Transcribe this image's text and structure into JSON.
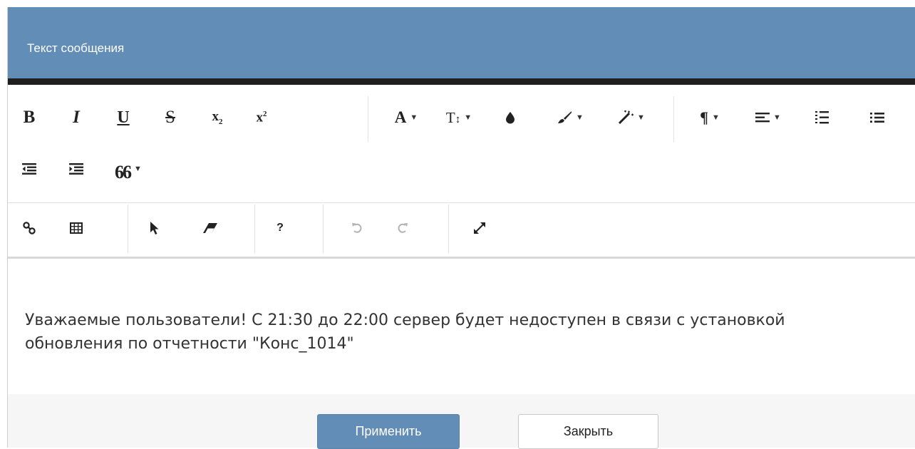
{
  "header": {
    "title": "Текст сообщения"
  },
  "colors": {
    "header_bg": "#628db7",
    "apply_bg": "#628db7"
  },
  "toolbar": {
    "bold": "B",
    "italic": "I",
    "underline": "U",
    "strikethrough": "S",
    "subscript_base": "x",
    "subscript_mark": "2",
    "superscript_base": "x",
    "superscript_mark": "2",
    "font_color": "A",
    "font_size": "T",
    "font_size_arrows": "↕",
    "paragraph": "¶",
    "quote": "66",
    "help": "?",
    "caret": "▼"
  },
  "icons": [
    "bold-icon",
    "italic-icon",
    "underline-icon",
    "strikethrough-icon",
    "subscript-icon",
    "superscript-icon",
    "font-color-icon",
    "font-size-icon",
    "drop-icon",
    "brush-icon",
    "magic-wand-icon",
    "paragraph-icon",
    "align-icon",
    "ordered-list-icon",
    "unordered-list-icon",
    "outdent-icon",
    "indent-icon",
    "quote-icon",
    "link-icon",
    "table-icon",
    "cursor-icon",
    "eraser-icon",
    "help-icon",
    "undo-icon",
    "redo-icon",
    "fullscreen-icon"
  ],
  "editor": {
    "message": "Уважаемые пользователи! С 21:30 до 22:00 сервер будет недоступен в связи с установкой обновления по отчетности \"Конс_1014\""
  },
  "footer": {
    "apply_label": "Применить",
    "close_label": "Закрыть"
  }
}
